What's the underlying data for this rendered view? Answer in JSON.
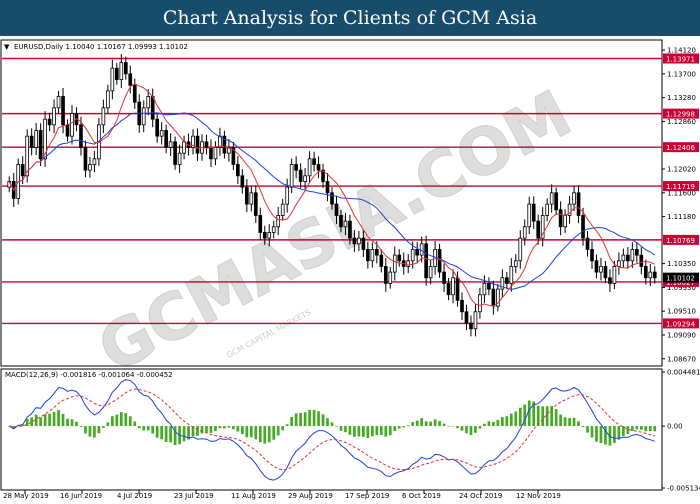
{
  "banner": {
    "title": "Chart Analysis for Clients of GCM Asia"
  },
  "watermark": "GCMASIA.COM",
  "watermark_sub": "GCM CAPITAL MARKETS",
  "colors": {
    "banner_bg": "#174d6b",
    "hline": "#cc0033",
    "ma_fast": "#e0303a",
    "ma_slow": "#1f3fe0",
    "macd_line": "#1f3fe0",
    "signal_line": "#e0303a",
    "histogram": "#44aa22",
    "candle": "#000000"
  },
  "chart_data": [
    {
      "type": "candlestick",
      "title": "EURUSD,Daily  1.10040 1.10167 1.09993 1.10102",
      "symbol_icon": "triangle-down-icon",
      "ylim": [
        1.0856,
        1.1428
      ],
      "yticks": [
        "1.14120",
        "1.13700",
        "1.13280",
        "1.12860",
        "1.12020",
        "1.11600",
        "1.11180",
        "1.10350",
        "1.09930",
        "1.09510",
        "1.09090",
        "1.08670"
      ],
      "xticks": [
        "28 May 2019",
        "16 Jun 2019",
        "4 Jul 2019",
        "23 Jul 2019",
        "11 Aug 2019",
        "29 Aug 2019",
        "17 Sep 2019",
        "6 Oct 2019",
        "24 Oct 2019",
        "12 Nov 2019"
      ],
      "levels": [
        {
          "label": "1.13971",
          "value": 1.13971
        },
        {
          "label": "1.12998",
          "value": 1.12998
        },
        {
          "label": "1.12406",
          "value": 1.12406
        },
        {
          "label": "1.11719",
          "value": 1.11719
        },
        {
          "label": "1.10769",
          "value": 1.10769
        },
        {
          "label": "1.10027",
          "value": 1.10027
        },
        {
          "label": "1.09294",
          "value": 1.09294
        }
      ],
      "current_price": {
        "label": "1.10102",
        "value": 1.10102
      },
      "close_series": [
        1.118,
        1.115,
        1.121,
        1.119,
        1.126,
        1.124,
        1.127,
        1.122,
        1.129,
        1.128,
        1.131,
        1.133,
        1.128,
        1.126,
        1.13,
        1.128,
        1.124,
        1.12,
        1.121,
        1.122,
        1.128,
        1.131,
        1.134,
        1.138,
        1.136,
        1.139,
        1.137,
        1.135,
        1.132,
        1.128,
        1.131,
        1.133,
        1.129,
        1.126,
        1.127,
        1.124,
        1.125,
        1.121,
        1.123,
        1.125,
        1.124,
        1.126,
        1.123,
        1.125,
        1.124,
        1.122,
        1.124,
        1.126,
        1.123,
        1.124,
        1.121,
        1.119,
        1.117,
        1.114,
        1.116,
        1.112,
        1.109,
        1.108,
        1.109,
        1.11,
        1.112,
        1.114,
        1.117,
        1.121,
        1.12,
        1.118,
        1.119,
        1.122,
        1.121,
        1.12,
        1.118,
        1.116,
        1.114,
        1.112,
        1.11,
        1.111,
        1.108,
        1.107,
        1.108,
        1.106,
        1.104,
        1.106,
        1.105,
        1.103,
        1.1,
        1.102,
        1.105,
        1.104,
        1.103,
        1.104,
        1.106,
        1.105,
        1.107,
        1.101,
        1.103,
        1.106,
        1.102,
        1.1,
        1.098,
        1.101,
        1.097,
        1.095,
        1.093,
        1.092,
        1.095,
        1.098,
        1.1,
        1.099,
        1.096,
        1.099,
        1.101,
        1.1,
        1.103,
        1.104,
        1.108,
        1.11,
        1.114,
        1.111,
        1.108,
        1.112,
        1.114,
        1.116,
        1.113,
        1.11,
        1.112,
        1.114,
        1.116,
        1.112,
        1.108,
        1.106,
        1.104,
        1.102,
        1.103,
        1.101,
        1.1,
        1.103,
        1.104,
        1.105,
        1.104,
        1.106,
        1.105,
        1.103,
        1.101,
        1.102,
        1.101
      ]
    },
    {
      "type": "macd",
      "title": "MACD(12,26,9) -0.001816 -0.001064 -0.000452",
      "ylim": [
        -0.005134,
        0.004481
      ],
      "yticks": [
        "0.004481",
        "0.00",
        "-0.005134"
      ]
    }
  ]
}
